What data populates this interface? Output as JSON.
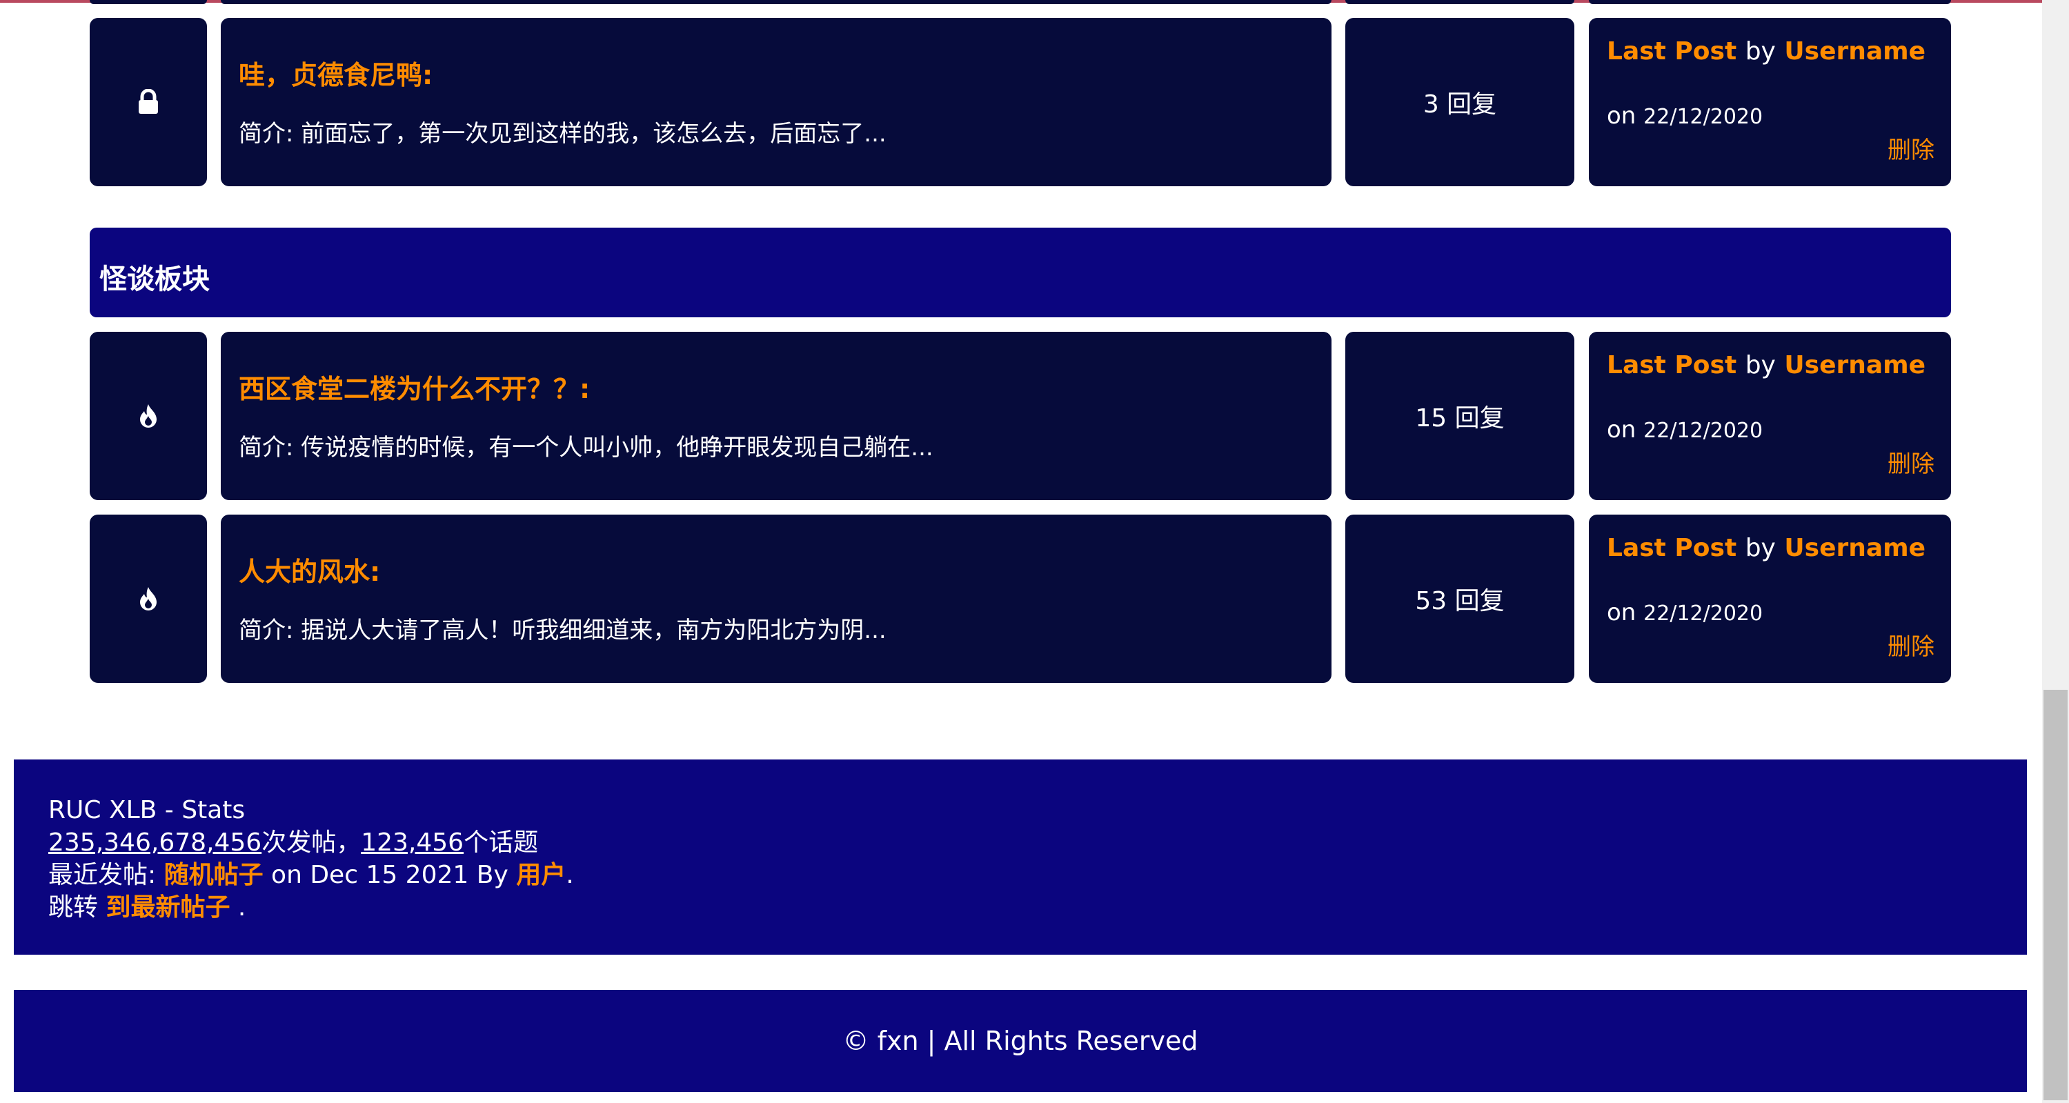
{
  "colors": {
    "card_bg": "#060b3b",
    "header_bg": "#0b057f",
    "accent": "#ff8c00",
    "text": "#ffffff"
  },
  "topics": [
    {
      "icon": "lock-icon",
      "title": "哇，贞德食尼鸭:",
      "excerpt": "简介: 前面忘了，第一次见到这样的我，该怎么去，后面忘了...",
      "replies": "3 回复",
      "last_post_label": "Last Post",
      "by": "by",
      "username": "Username",
      "on": "on",
      "date": "22/12/2020",
      "delete": "删除"
    },
    {
      "icon": "flame-icon",
      "title": "西区食堂二楼为什么不开？？:",
      "excerpt": "简介: 传说疫情的时候，有一个人叫小帅，他睁开眼发现自己躺在...",
      "replies": "15 回复",
      "last_post_label": "Last Post",
      "by": "by",
      "username": "Username",
      "on": "on",
      "date": "22/12/2020",
      "delete": "删除"
    },
    {
      "icon": "flame-icon",
      "title": "人大的风水:",
      "excerpt": "简介: 据说人大请了高人！听我细细道来，南方为阳北方为阴...",
      "replies": "53 回复",
      "last_post_label": "Last Post",
      "by": "by",
      "username": "Username",
      "on": "on",
      "date": "22/12/2020",
      "delete": "删除"
    }
  ],
  "section": {
    "title": "怪谈板块"
  },
  "stats": {
    "heading": "RUC XLB - Stats",
    "posts_count": "235,346,678,456",
    "posts_suffix": "次发帖，",
    "topics_count": "123,456",
    "topics_suffix": "个话题",
    "recent_label": "最近发帖: ",
    "recent_post": "随机帖子",
    "recent_on": " on Dec 15 2021 By ",
    "recent_user": "用户",
    "recent_end": ".",
    "jump_label": "跳转 ",
    "jump_link": "到最新帖子",
    "jump_end": " ."
  },
  "footer": {
    "text": "© fxn | All Rights Reserved"
  }
}
